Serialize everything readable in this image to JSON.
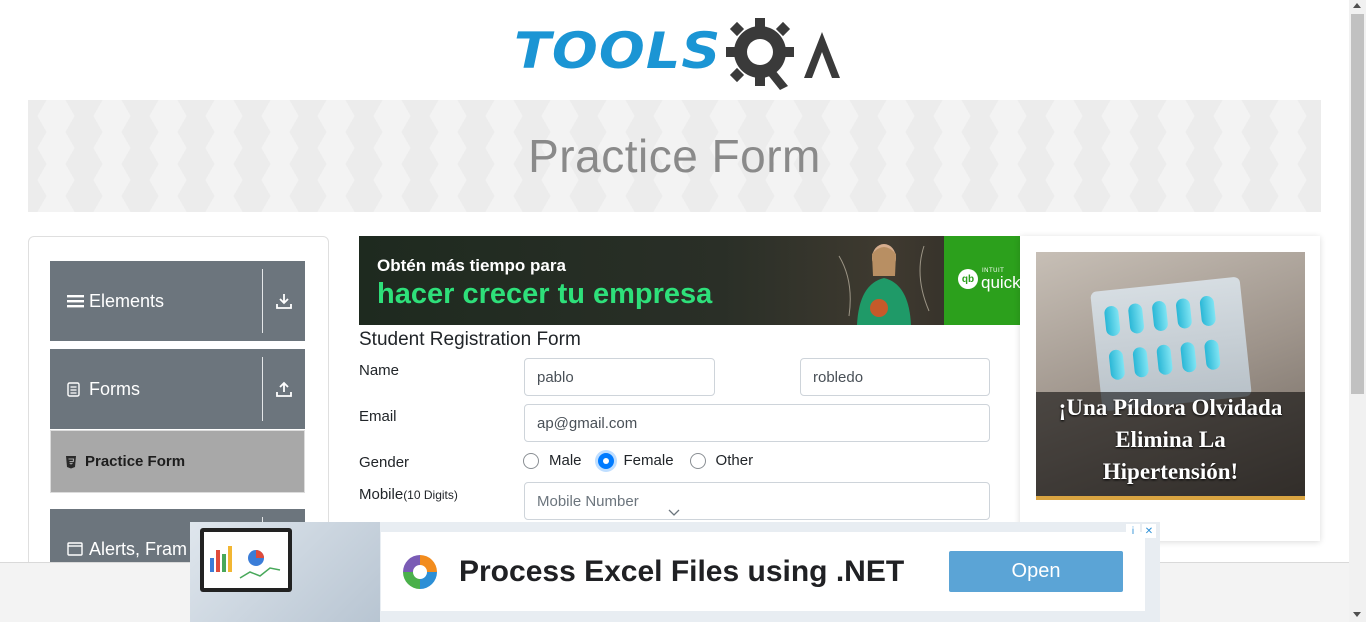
{
  "header": {
    "logo_text": "TOOLS",
    "logo_suffix": "QA",
    "page_title": "Practice Form"
  },
  "sidebar": {
    "groups": [
      {
        "label": "Elements",
        "icon": "hamburger-icon",
        "toggle_icon": "download-arrow-icon"
      },
      {
        "label": "Forms",
        "icon": "document-icon",
        "toggle_icon": "upload-arrow-icon"
      },
      {
        "label": "Alerts, Fram",
        "icon": "window-icon"
      }
    ],
    "active_item": {
      "label": "Practice Form",
      "icon": "html5-icon"
    }
  },
  "ad_top": {
    "line1": "Obtén más tiempo para",
    "line2": "hacer crecer tu empresa",
    "brand_badge": "qb",
    "brand_intuit": "INTUIT",
    "brand_name": "quick"
  },
  "form": {
    "title": "Student Registration Form",
    "name_label": "Name",
    "first_name_value": "pablo",
    "last_name_value": "robledo",
    "email_label": "Email",
    "email_value": "ap@gmail.com",
    "gender_label": "Gender",
    "gender_options": [
      "Male",
      "Female",
      "Other"
    ],
    "gender_selected": "Female",
    "mobile_label": "Mobile",
    "mobile_hint": "(10 Digits)",
    "mobile_placeholder": "Mobile Number"
  },
  "ad_right": {
    "caption_line1": "¡Una Píldora Olvidada",
    "caption_line2": "Elimina La",
    "caption_line3": "Hipertensión!"
  },
  "ad_bottom": {
    "title": "Process Excel Files using .NET",
    "button_label": "Open",
    "info_icon": "i",
    "close_icon": "✕"
  },
  "colors": {
    "brand_blue": "#1b95d4",
    "sidebar_group": "#6c757d",
    "sidebar_active": "#a8a8a8",
    "radio_checked": "#007bff",
    "ad_green": "#2ca01c",
    "open_button": "#5ba4d6"
  }
}
